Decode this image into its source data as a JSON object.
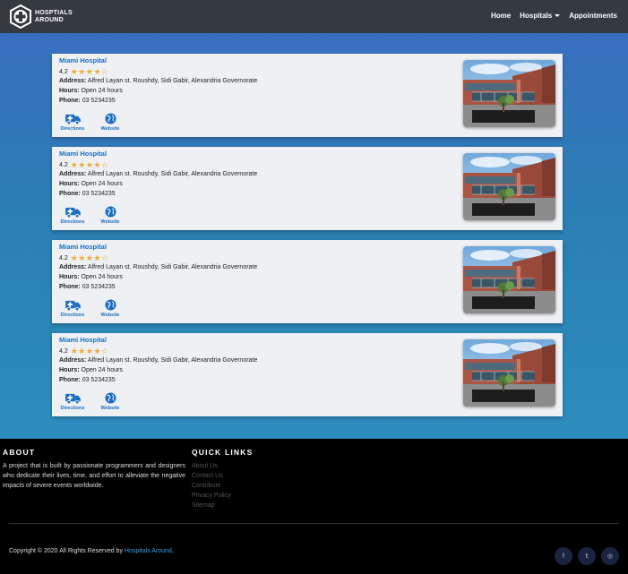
{
  "navbar": {
    "brand_line1": "HOSPTIALS",
    "brand_line2": "AROUND",
    "links": [
      "Home",
      "Hospitals",
      "Appointments"
    ]
  },
  "hospitals": [
    {
      "name": "Miami Hospital",
      "rating": "4.2",
      "stars_filled": 4,
      "stars_total": 5,
      "address_label": "Address:",
      "address": "Alfred Layan st. Roushdy, Sidi Gabir, Alexandria Governorate",
      "hours_label": "Hours:",
      "hours": "Open 24 hours",
      "phone_label": "Phone:",
      "phone": "03 5234235",
      "directions_label": "Directions",
      "website_label": "Website"
    },
    {
      "name": "Miami Hospital",
      "rating": "4.2",
      "stars_filled": 4,
      "stars_total": 5,
      "address_label": "Address:",
      "address": "Alfred Layan st. Roushdy, Sidi Gabir, Alexandria Governorate",
      "hours_label": "Hours:",
      "hours": "Open 24 hours",
      "phone_label": "Phone:",
      "phone": "03 5234235",
      "directions_label": "Directions",
      "website_label": "Website"
    },
    {
      "name": "Miami Hospital",
      "rating": "4.2",
      "stars_filled": 4,
      "stars_total": 5,
      "address_label": "Address:",
      "address": "Alfred Layan st. Roushdy, Sidi Gabir, Alexandria Governorate",
      "hours_label": "Hours:",
      "hours": "Open 24 hours",
      "phone_label": "Phone:",
      "phone": "03 5234235",
      "directions_label": "Directions",
      "website_label": "Website"
    },
    {
      "name": "Miami Hospital",
      "rating": "4.2",
      "stars_filled": 4,
      "stars_total": 5,
      "address_label": "Address:",
      "address": "Alfred Layan st. Roushdy, Sidi Gabir, Alexandria Governorate",
      "hours_label": "Hours:",
      "hours": "Open 24 hours",
      "phone_label": "Phone:",
      "phone": "03 5234235",
      "directions_label": "Directions",
      "website_label": "Website"
    }
  ],
  "footer": {
    "about_heading": "ABOUT",
    "about_text": "A project that is built by passionate programmers and designers who dedicate their lives, time, and effort to alleviate the negative impacts of severe events worldwide.",
    "links_heading": "QUICK LINKS",
    "links": [
      "About Us",
      "Contact Us",
      "Contribute",
      "Privacy Policy",
      "Sitemap"
    ],
    "copyright_prefix": "Copyright © 2020 All Rights Reserved by",
    "copyright_brand": "Hospitals Around",
    "copyright_suffix": ".",
    "social": [
      {
        "icon": "facebook-icon",
        "glyph": "f"
      },
      {
        "icon": "twitter-icon",
        "glyph": "𝕥"
      },
      {
        "icon": "instagram-icon",
        "glyph": "◎"
      }
    ]
  },
  "colors": {
    "navbar": "#343a40",
    "accent": "#1b6ec2",
    "star": "#f0a830",
    "footer": "#000000"
  }
}
